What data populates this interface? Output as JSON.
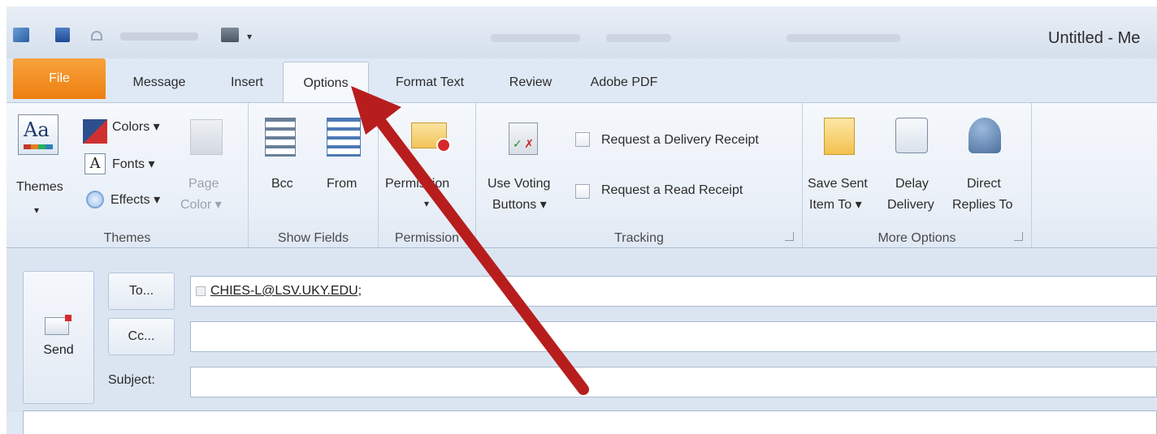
{
  "window": {
    "title": "Untitled - Me"
  },
  "tabs": [
    {
      "label": "File"
    },
    {
      "label": "Message"
    },
    {
      "label": "Insert"
    },
    {
      "label": "Options"
    },
    {
      "label": "Format Text"
    },
    {
      "label": "Review"
    },
    {
      "label": "Adobe PDF"
    }
  ],
  "ribbon": {
    "themes": {
      "label": "Themes",
      "themes_button": "Themes",
      "colors": "Colors ▾",
      "fonts": "Fonts ▾",
      "effects": "Effects ▾",
      "page_color_1": "Page",
      "page_color_2": "Color ▾"
    },
    "show_fields": {
      "label": "Show Fields",
      "bcc": "Bcc",
      "from": "From"
    },
    "permission": {
      "label": "Permission",
      "button": "Permission"
    },
    "tracking": {
      "label": "Tracking",
      "voting_1": "Use Voting",
      "voting_2": "Buttons ▾",
      "delivery_receipt": "Request a Delivery Receipt",
      "read_receipt": "Request a Read Receipt"
    },
    "more_options": {
      "label": "More Options",
      "save_sent_1": "Save Sent",
      "save_sent_2": "Item To ▾",
      "delay_1": "Delay",
      "delay_2": "Delivery",
      "direct_1": "Direct",
      "direct_2": "Replies To"
    }
  },
  "compose": {
    "send": "Send",
    "to_button": "To...",
    "cc_button": "Cc...",
    "subject_label": "Subject:",
    "to_value": "CHIES-L@LSV.UKY.EDU;",
    "cc_value": "",
    "subject_value": ""
  },
  "colors": {
    "file_tab": "#ee7f10",
    "arrow": "#b81d1d",
    "ribbon_bg": "#eaf0f8"
  }
}
